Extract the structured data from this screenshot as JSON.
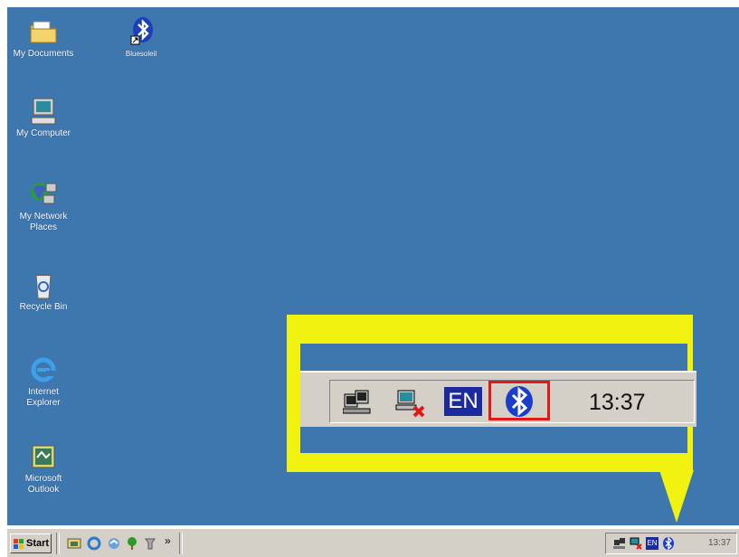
{
  "desktop": {
    "icons": [
      {
        "label": "My Documents",
        "icon": "folder-icon"
      },
      {
        "label": "Bluesoleil",
        "icon": "bluetooth-icon"
      },
      {
        "label": "My Computer",
        "icon": "computer-icon"
      },
      {
        "label": "My Network Places",
        "line1": "My Network",
        "line2": "Places",
        "icon": "network-icon"
      },
      {
        "label": "Recycle Bin",
        "icon": "recycle-bin-icon"
      },
      {
        "label": "Internet Explorer",
        "line1": "Internet",
        "line2": "Explorer",
        "icon": "ie-icon"
      },
      {
        "label": "Microsoft Outlook",
        "line1": "Microsoft",
        "line2": "Outlook",
        "icon": "outlook-icon"
      }
    ],
    "background": "#3e76ae"
  },
  "taskbar": {
    "start_label": "Start",
    "quick_launch_overflow": "»",
    "tray": {
      "icons": [
        "network-icon",
        "disconnected-network-icon",
        "language-en-icon",
        "bluetooth-icon"
      ],
      "language": "EN",
      "clock": "13:37"
    }
  },
  "callout": {
    "color": "#f2f211",
    "highlight_color": "#e01818",
    "language": "EN",
    "clock": "13:37"
  }
}
